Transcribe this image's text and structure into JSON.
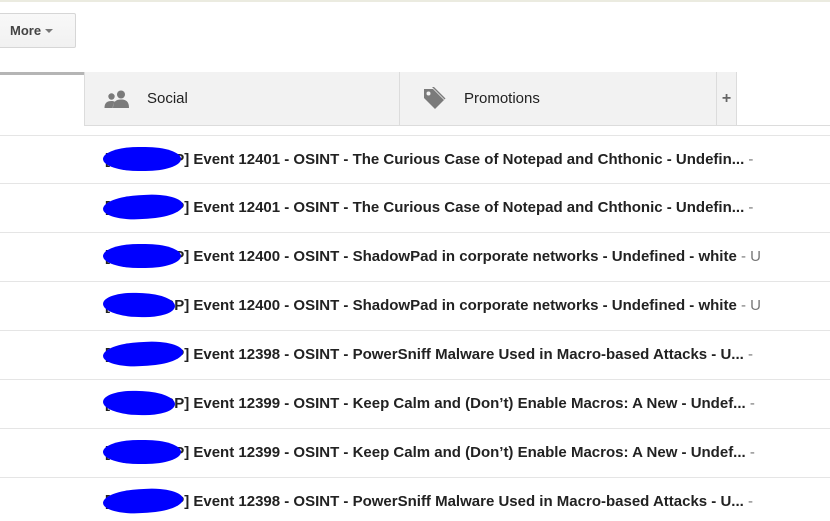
{
  "toolbar": {
    "more_label": "More"
  },
  "tabs": {
    "social": {
      "label": "Social",
      "icon": "people-icon"
    },
    "promotions": {
      "label": "Promotions",
      "icon": "tag-icon"
    },
    "add_label": "+"
  },
  "emails": [
    {
      "subject": "[xxxx MISP] Event 12401 - OSINT - The Curious Case of Notepad and Chthonic - Undefin...",
      "trail": " -"
    },
    {
      "subject": "[xxxx MISP] Event 12401 - OSINT - The Curious Case of Notepad and Chthonic - Undefin...",
      "trail": " -"
    },
    {
      "subject": "[xxxx MISP] Event 12400 - OSINT - ShadowPad in corporate networks - Undefined - white",
      "trail": " - U"
    },
    {
      "subject": "[xxxx MISP] Event 12400 - OSINT - ShadowPad in corporate networks - Undefined - white",
      "trail": " - U"
    },
    {
      "subject": "[xxxx MISP] Event 12398 - OSINT - PowerSniff Malware Used in Macro-based Attacks - U...",
      "trail": " -"
    },
    {
      "subject": "[xxxx MISP] Event 12399 - OSINT - Keep Calm and (Don’t) Enable Macros: A New - Undef...",
      "trail": " -"
    },
    {
      "subject": "[xxxx MISP] Event 12399 - OSINT - Keep Calm and (Don’t) Enable Macros: A New - Undef...",
      "trail": " -"
    },
    {
      "subject": "[xxxx MISP] Event 12398 - OSINT - PowerSniff Malware Used in Macro-based Attacks - U...",
      "trail": " -"
    }
  ],
  "colors": {
    "redaction": "#0000ff",
    "tab_background": "#f2f2f2"
  }
}
